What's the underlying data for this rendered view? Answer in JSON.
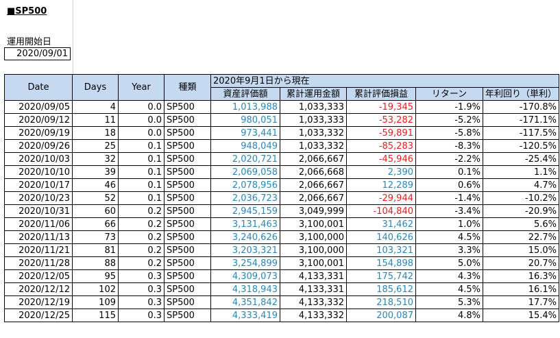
{
  "sheet": {
    "title": "■SP500",
    "start_label": "運用開始日",
    "start_date": "2020/09/01"
  },
  "table": {
    "headers": {
      "date": "Date",
      "days": "Days",
      "year": "Year",
      "type": "種類",
      "group": "2020年9月1日から現在",
      "asset": "資産評価額",
      "invested": "累計運用金額",
      "pnl": "累計評価損益",
      "return": "リターン",
      "annual": "年利回り（単利）"
    },
    "rows": [
      [
        "2020/09/05",
        "4",
        "0.0",
        "SP500",
        "1,013,988",
        "1,033,333",
        "-19,345",
        "-1.9%",
        "-170.8%"
      ],
      [
        "2020/09/12",
        "11",
        "0.0",
        "SP500",
        "980,051",
        "1,033,333",
        "-53,282",
        "-5.2%",
        "-171.1%"
      ],
      [
        "2020/09/19",
        "18",
        "0.0",
        "SP500",
        "973,441",
        "1,033,332",
        "-59,891",
        "-5.8%",
        "-117.5%"
      ],
      [
        "2020/09/26",
        "25",
        "0.1",
        "SP500",
        "948,049",
        "1,033,332",
        "-85,283",
        "-8.3%",
        "-120.5%"
      ],
      [
        "2020/10/03",
        "32",
        "0.1",
        "SP500",
        "2,020,721",
        "2,066,667",
        "-45,946",
        "-2.2%",
        "-25.4%"
      ],
      [
        "2020/10/10",
        "39",
        "0.1",
        "SP500",
        "2,069,058",
        "2,066,668",
        "2,390",
        "0.1%",
        "1.1%"
      ],
      [
        "2020/10/17",
        "46",
        "0.1",
        "SP500",
        "2,078,956",
        "2,066,667",
        "12,289",
        "0.6%",
        "4.7%"
      ],
      [
        "2020/10/23",
        "52",
        "0.1",
        "SP500",
        "2,036,723",
        "2,066,667",
        "-29,944",
        "-1.4%",
        "-10.2%"
      ],
      [
        "2020/10/31",
        "60",
        "0.2",
        "SP500",
        "2,945,159",
        "3,049,999",
        "-104,840",
        "-3.4%",
        "-20.9%"
      ],
      [
        "2020/11/06",
        "66",
        "0.2",
        "SP500",
        "3,131,463",
        "3,100,001",
        "31,462",
        "1.0%",
        "5.6%"
      ],
      [
        "2020/11/13",
        "73",
        "0.2",
        "SP500",
        "3,240,626",
        "3,100,000",
        "140,626",
        "4.5%",
        "22.7%"
      ],
      [
        "2020/11/21",
        "81",
        "0.2",
        "SP500",
        "3,203,321",
        "3,100,000",
        "103,321",
        "3.3%",
        "15.0%"
      ],
      [
        "2020/11/28",
        "88",
        "0.2",
        "SP500",
        "3,254,899",
        "3,100,001",
        "154,898",
        "5.0%",
        "20.7%"
      ],
      [
        "2020/12/05",
        "95",
        "0.3",
        "SP500",
        "4,309,073",
        "4,133,331",
        "175,742",
        "4.3%",
        "16.3%"
      ],
      [
        "2020/12/12",
        "102",
        "0.3",
        "SP500",
        "4,318,943",
        "4,133,331",
        "185,612",
        "4.5%",
        "16.1%"
      ],
      [
        "2020/12/19",
        "109",
        "0.3",
        "SP500",
        "4,351,842",
        "4,133,332",
        "218,510",
        "5.3%",
        "17.7%"
      ],
      [
        "2020/12/25",
        "115",
        "0.3",
        "SP500",
        "4,333,419",
        "4,133,332",
        "200,087",
        "4.8%",
        "15.4%"
      ]
    ]
  },
  "colors": {
    "header_bg": "#c5d9f1",
    "positive": "#2a86b8",
    "negative": "#e02020"
  }
}
